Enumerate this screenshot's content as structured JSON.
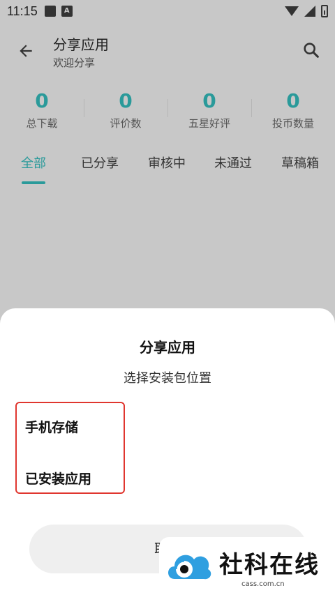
{
  "status_bar": {
    "time": "11:15",
    "notification_icon_letter": "A"
  },
  "header": {
    "title": "分享应用",
    "subtitle": "欢迎分享"
  },
  "stats": [
    {
      "value": "0",
      "label": "总下载"
    },
    {
      "value": "0",
      "label": "评价数"
    },
    {
      "value": "0",
      "label": "五星好评"
    },
    {
      "value": "0",
      "label": "投币数量"
    }
  ],
  "tabs": [
    {
      "label": "全部",
      "active": true
    },
    {
      "label": "已分享",
      "active": false
    },
    {
      "label": "审核中",
      "active": false
    },
    {
      "label": "未通过",
      "active": false
    },
    {
      "label": "草稿箱",
      "active": false
    }
  ],
  "sheet": {
    "title": "分享应用",
    "subtitle": "选择安装包位置",
    "options": [
      "手机存储",
      "已安装应用"
    ],
    "cancel_label": "取消"
  },
  "watermark": {
    "text": "社科在线",
    "sub": "cass.com.cn"
  },
  "colors": {
    "accent": "#2a9a9a",
    "highlight_border": "#e0362f",
    "scrim_background": "#c8c8c8"
  }
}
